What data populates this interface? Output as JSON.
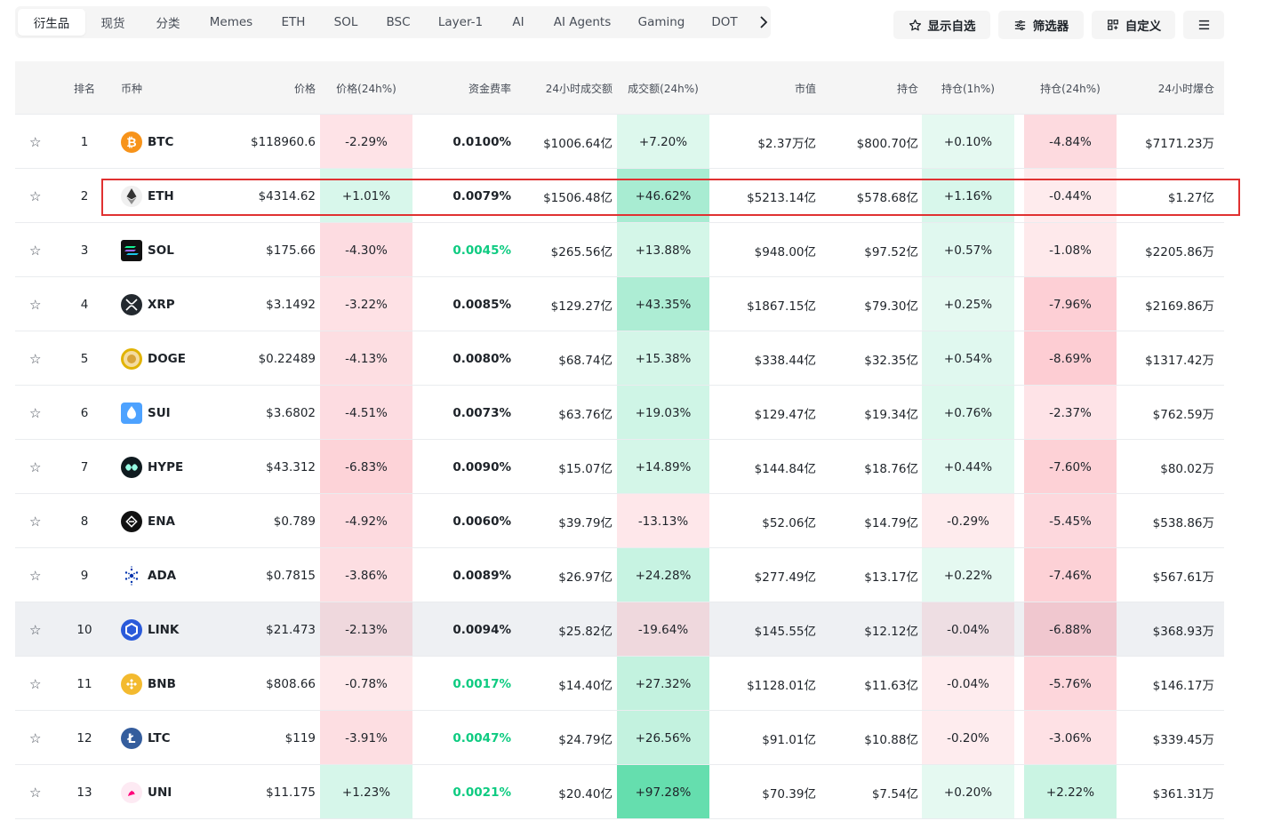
{
  "tabs": [
    {
      "label": "衍生品",
      "active": true
    },
    {
      "label": "现货"
    },
    {
      "label": "分类"
    },
    {
      "label": "Memes"
    },
    {
      "label": "ETH"
    },
    {
      "label": "SOL"
    },
    {
      "label": "BSC"
    },
    {
      "label": "Layer-1"
    },
    {
      "label": "AI"
    },
    {
      "label": "AI Agents"
    },
    {
      "label": "Gaming"
    },
    {
      "label": "DOT"
    }
  ],
  "actions": {
    "watchlist_label": "显示自选",
    "filter_label": "筛选器",
    "customize_label": "自定义"
  },
  "columns": {
    "rank": "排名",
    "coin": "币种",
    "price": "价格",
    "change": "价格(24h%)",
    "funding": "资金费率",
    "volume": "24小时成交额",
    "volume_change": "成交额(24h%)",
    "mcap": "市值",
    "oi": "持仓",
    "oi_1h": "持仓(1h%)",
    "oi_24h": "持仓(24h%)",
    "liq": "24小时爆仓"
  },
  "rows": [
    {
      "rank": "1",
      "symbol": "BTC",
      "icon": "bitcoin-icon",
      "price": "$118960.6",
      "change": "-2.29%",
      "funding": "0.0100%",
      "volume": "$1006.64亿",
      "volume_change": "+7.20%",
      "mcap": "$2.37万亿",
      "oi": "$800.70亿",
      "oi_1h": "+0.10%",
      "oi_24h": "-4.84%",
      "liq": "$7171.23万"
    },
    {
      "rank": "2",
      "symbol": "ETH",
      "icon": "ethereum-icon",
      "price": "$4314.62",
      "change": "+1.01%",
      "funding": "0.0079%",
      "volume": "$1506.48亿",
      "volume_change": "+46.62%",
      "mcap": "$5213.14亿",
      "oi": "$578.68亿",
      "oi_1h": "+1.16%",
      "oi_24h": "-0.44%",
      "liq": "$1.27亿"
    },
    {
      "rank": "3",
      "symbol": "SOL",
      "icon": "solana-icon",
      "price": "$175.66",
      "change": "-4.30%",
      "funding": "0.0045%",
      "volume": "$265.56亿",
      "volume_change": "+13.88%",
      "mcap": "$948.00亿",
      "oi": "$97.52亿",
      "oi_1h": "+0.57%",
      "oi_24h": "-1.08%",
      "liq": "$2205.86万"
    },
    {
      "rank": "4",
      "symbol": "XRP",
      "icon": "xrp-icon",
      "price": "$3.1492",
      "change": "-3.22%",
      "funding": "0.0085%",
      "volume": "$129.27亿",
      "volume_change": "+43.35%",
      "mcap": "$1867.15亿",
      "oi": "$79.30亿",
      "oi_1h": "+0.25%",
      "oi_24h": "-7.96%",
      "liq": "$2169.86万"
    },
    {
      "rank": "5",
      "symbol": "DOGE",
      "icon": "dogecoin-icon",
      "price": "$0.22489",
      "change": "-4.13%",
      "funding": "0.0080%",
      "volume": "$68.74亿",
      "volume_change": "+15.38%",
      "mcap": "$338.44亿",
      "oi": "$32.35亿",
      "oi_1h": "+0.54%",
      "oi_24h": "-8.69%",
      "liq": "$1317.42万"
    },
    {
      "rank": "6",
      "symbol": "SUI",
      "icon": "sui-icon",
      "price": "$3.6802",
      "change": "-4.51%",
      "funding": "0.0073%",
      "volume": "$63.76亿",
      "volume_change": "+19.03%",
      "mcap": "$129.47亿",
      "oi": "$19.34亿",
      "oi_1h": "+0.76%",
      "oi_24h": "-2.37%",
      "liq": "$762.59万"
    },
    {
      "rank": "7",
      "symbol": "HYPE",
      "icon": "hyperliquid-icon",
      "price": "$43.312",
      "change": "-6.83%",
      "funding": "0.0090%",
      "volume": "$15.07亿",
      "volume_change": "+14.89%",
      "mcap": "$144.84亿",
      "oi": "$18.76亿",
      "oi_1h": "+0.44%",
      "oi_24h": "-7.60%",
      "liq": "$80.02万"
    },
    {
      "rank": "8",
      "symbol": "ENA",
      "icon": "ethena-icon",
      "price": "$0.789",
      "change": "-4.92%",
      "funding": "0.0060%",
      "volume": "$39.79亿",
      "volume_change": "-13.13%",
      "mcap": "$52.06亿",
      "oi": "$14.79亿",
      "oi_1h": "-0.29%",
      "oi_24h": "-5.45%",
      "liq": "$538.86万"
    },
    {
      "rank": "9",
      "symbol": "ADA",
      "icon": "cardano-icon",
      "price": "$0.7815",
      "change": "-3.86%",
      "funding": "0.0089%",
      "volume": "$26.97亿",
      "volume_change": "+24.28%",
      "mcap": "$277.49亿",
      "oi": "$13.17亿",
      "oi_1h": "+0.22%",
      "oi_24h": "-7.46%",
      "liq": "$567.61万"
    },
    {
      "rank": "10",
      "symbol": "LINK",
      "icon": "chainlink-icon",
      "price": "$21.473",
      "change": "-2.13%",
      "funding": "0.0094%",
      "volume": "$25.82亿",
      "volume_change": "-19.64%",
      "mcap": "$145.55亿",
      "oi": "$12.12亿",
      "oi_1h": "-0.04%",
      "oi_24h": "-6.88%",
      "liq": "$368.93万"
    },
    {
      "rank": "11",
      "symbol": "BNB",
      "icon": "bnb-icon",
      "price": "$808.66",
      "change": "-0.78%",
      "funding": "0.0017%",
      "volume": "$14.40亿",
      "volume_change": "+27.32%",
      "mcap": "$1128.01亿",
      "oi": "$11.63亿",
      "oi_1h": "-0.04%",
      "oi_24h": "-5.76%",
      "liq": "$146.17万"
    },
    {
      "rank": "12",
      "symbol": "LTC",
      "icon": "litecoin-icon",
      "price": "$119",
      "change": "-3.91%",
      "funding": "0.0047%",
      "volume": "$24.79亿",
      "volume_change": "+26.56%",
      "mcap": "$91.01亿",
      "oi": "$10.88亿",
      "oi_1h": "-0.20%",
      "oi_24h": "-3.06%",
      "liq": "$339.45万"
    },
    {
      "rank": "13",
      "symbol": "UNI",
      "icon": "uniswap-icon",
      "price": "$11.175",
      "change": "+1.23%",
      "funding": "0.0021%",
      "volume": "$20.40亿",
      "volume_change": "+97.28%",
      "mcap": "$70.39亿",
      "oi": "$7.54亿",
      "oi_1h": "+0.20%",
      "oi_24h": "+2.22%",
      "liq": "$361.31万"
    }
  ],
  "colors": {
    "up": "#0ecb81",
    "down": "#f6465d",
    "highlight_border": "#e03131"
  }
}
